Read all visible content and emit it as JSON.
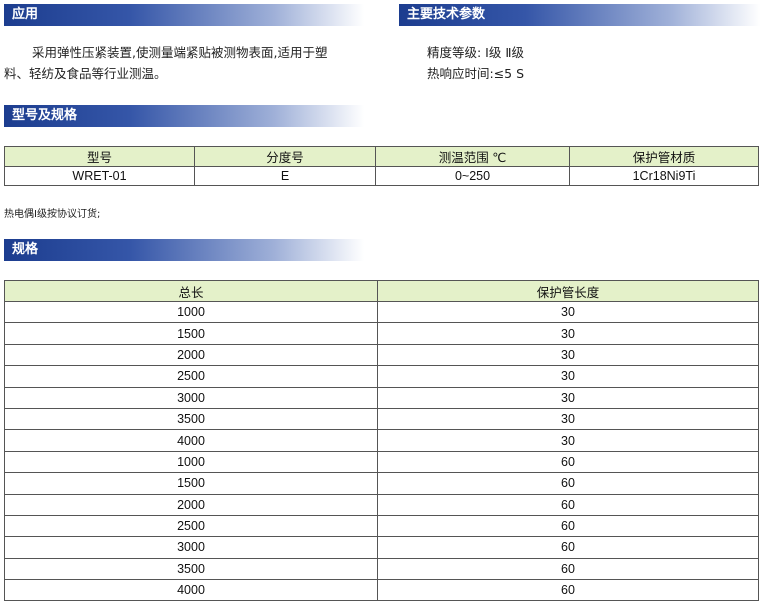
{
  "sections": {
    "application": {
      "title": "应用",
      "text_line1": "采用弹性压紧装置,使测量端紧贴被测物表面,适用于塑",
      "text_line2": "料、轻纺及食品等行业测温。"
    },
    "main_params": {
      "title": "主要技术参数",
      "line1": "精度等级: Ⅰ级 Ⅱ级",
      "line2": "热响应时间:≤5 S"
    },
    "model_spec": {
      "title": "型号及规格",
      "headers": [
        "型号",
        "分度号",
        "测温范围 ℃",
        "保护管材质"
      ],
      "row": [
        "WRET-01",
        "E",
        "0~250",
        "1Cr18Ni9Ti"
      ],
      "note": "热电偶Ⅰ级按协议订货;"
    },
    "spec": {
      "title": "规格",
      "headers": [
        "总长",
        "保护管长度"
      ],
      "rows": [
        [
          "1000",
          "30"
        ],
        [
          "1500",
          "30"
        ],
        [
          "2000",
          "30"
        ],
        [
          "2500",
          "30"
        ],
        [
          "3000",
          "30"
        ],
        [
          "3500",
          "30"
        ],
        [
          "4000",
          "30"
        ],
        [
          "1000",
          "60"
        ],
        [
          "1500",
          "60"
        ],
        [
          "2000",
          "60"
        ],
        [
          "2500",
          "60"
        ],
        [
          "3000",
          "60"
        ],
        [
          "3500",
          "60"
        ],
        [
          "4000",
          "60"
        ]
      ]
    }
  }
}
